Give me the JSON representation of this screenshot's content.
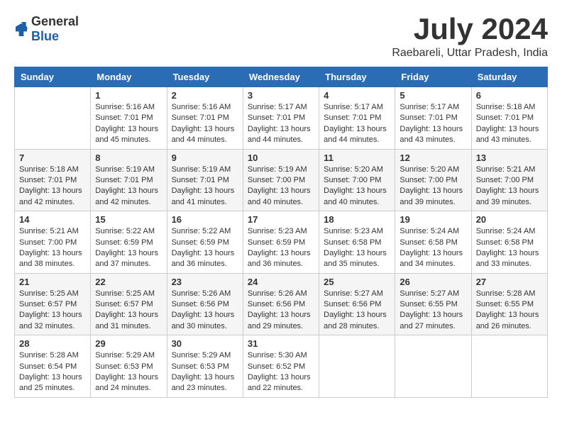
{
  "logo": {
    "text_general": "General",
    "text_blue": "Blue"
  },
  "title": {
    "month_year": "July 2024",
    "location": "Raebareli, Uttar Pradesh, India"
  },
  "headers": [
    "Sunday",
    "Monday",
    "Tuesday",
    "Wednesday",
    "Thursday",
    "Friday",
    "Saturday"
  ],
  "weeks": [
    [
      {
        "day": "",
        "sunrise": "",
        "sunset": "",
        "daylight": ""
      },
      {
        "day": "1",
        "sunrise": "Sunrise: 5:16 AM",
        "sunset": "Sunset: 7:01 PM",
        "daylight": "Daylight: 13 hours and 45 minutes."
      },
      {
        "day": "2",
        "sunrise": "Sunrise: 5:16 AM",
        "sunset": "Sunset: 7:01 PM",
        "daylight": "Daylight: 13 hours and 44 minutes."
      },
      {
        "day": "3",
        "sunrise": "Sunrise: 5:17 AM",
        "sunset": "Sunset: 7:01 PM",
        "daylight": "Daylight: 13 hours and 44 minutes."
      },
      {
        "day": "4",
        "sunrise": "Sunrise: 5:17 AM",
        "sunset": "Sunset: 7:01 PM",
        "daylight": "Daylight: 13 hours and 44 minutes."
      },
      {
        "day": "5",
        "sunrise": "Sunrise: 5:17 AM",
        "sunset": "Sunset: 7:01 PM",
        "daylight": "Daylight: 13 hours and 43 minutes."
      },
      {
        "day": "6",
        "sunrise": "Sunrise: 5:18 AM",
        "sunset": "Sunset: 7:01 PM",
        "daylight": "Daylight: 13 hours and 43 minutes."
      }
    ],
    [
      {
        "day": "7",
        "sunrise": "Sunrise: 5:18 AM",
        "sunset": "Sunset: 7:01 PM",
        "daylight": "Daylight: 13 hours and 42 minutes."
      },
      {
        "day": "8",
        "sunrise": "Sunrise: 5:19 AM",
        "sunset": "Sunset: 7:01 PM",
        "daylight": "Daylight: 13 hours and 42 minutes."
      },
      {
        "day": "9",
        "sunrise": "Sunrise: 5:19 AM",
        "sunset": "Sunset: 7:01 PM",
        "daylight": "Daylight: 13 hours and 41 minutes."
      },
      {
        "day": "10",
        "sunrise": "Sunrise: 5:19 AM",
        "sunset": "Sunset: 7:00 PM",
        "daylight": "Daylight: 13 hours and 40 minutes."
      },
      {
        "day": "11",
        "sunrise": "Sunrise: 5:20 AM",
        "sunset": "Sunset: 7:00 PM",
        "daylight": "Daylight: 13 hours and 40 minutes."
      },
      {
        "day": "12",
        "sunrise": "Sunrise: 5:20 AM",
        "sunset": "Sunset: 7:00 PM",
        "daylight": "Daylight: 13 hours and 39 minutes."
      },
      {
        "day": "13",
        "sunrise": "Sunrise: 5:21 AM",
        "sunset": "Sunset: 7:00 PM",
        "daylight": "Daylight: 13 hours and 39 minutes."
      }
    ],
    [
      {
        "day": "14",
        "sunrise": "Sunrise: 5:21 AM",
        "sunset": "Sunset: 7:00 PM",
        "daylight": "Daylight: 13 hours and 38 minutes."
      },
      {
        "day": "15",
        "sunrise": "Sunrise: 5:22 AM",
        "sunset": "Sunset: 6:59 PM",
        "daylight": "Daylight: 13 hours and 37 minutes."
      },
      {
        "day": "16",
        "sunrise": "Sunrise: 5:22 AM",
        "sunset": "Sunset: 6:59 PM",
        "daylight": "Daylight: 13 hours and 36 minutes."
      },
      {
        "day": "17",
        "sunrise": "Sunrise: 5:23 AM",
        "sunset": "Sunset: 6:59 PM",
        "daylight": "Daylight: 13 hours and 36 minutes."
      },
      {
        "day": "18",
        "sunrise": "Sunrise: 5:23 AM",
        "sunset": "Sunset: 6:58 PM",
        "daylight": "Daylight: 13 hours and 35 minutes."
      },
      {
        "day": "19",
        "sunrise": "Sunrise: 5:24 AM",
        "sunset": "Sunset: 6:58 PM",
        "daylight": "Daylight: 13 hours and 34 minutes."
      },
      {
        "day": "20",
        "sunrise": "Sunrise: 5:24 AM",
        "sunset": "Sunset: 6:58 PM",
        "daylight": "Daylight: 13 hours and 33 minutes."
      }
    ],
    [
      {
        "day": "21",
        "sunrise": "Sunrise: 5:25 AM",
        "sunset": "Sunset: 6:57 PM",
        "daylight": "Daylight: 13 hours and 32 minutes."
      },
      {
        "day": "22",
        "sunrise": "Sunrise: 5:25 AM",
        "sunset": "Sunset: 6:57 PM",
        "daylight": "Daylight: 13 hours and 31 minutes."
      },
      {
        "day": "23",
        "sunrise": "Sunrise: 5:26 AM",
        "sunset": "Sunset: 6:56 PM",
        "daylight": "Daylight: 13 hours and 30 minutes."
      },
      {
        "day": "24",
        "sunrise": "Sunrise: 5:26 AM",
        "sunset": "Sunset: 6:56 PM",
        "daylight": "Daylight: 13 hours and 29 minutes."
      },
      {
        "day": "25",
        "sunrise": "Sunrise: 5:27 AM",
        "sunset": "Sunset: 6:56 PM",
        "daylight": "Daylight: 13 hours and 28 minutes."
      },
      {
        "day": "26",
        "sunrise": "Sunrise: 5:27 AM",
        "sunset": "Sunset: 6:55 PM",
        "daylight": "Daylight: 13 hours and 27 minutes."
      },
      {
        "day": "27",
        "sunrise": "Sunrise: 5:28 AM",
        "sunset": "Sunset: 6:55 PM",
        "daylight": "Daylight: 13 hours and 26 minutes."
      }
    ],
    [
      {
        "day": "28",
        "sunrise": "Sunrise: 5:28 AM",
        "sunset": "Sunset: 6:54 PM",
        "daylight": "Daylight: 13 hours and 25 minutes."
      },
      {
        "day": "29",
        "sunrise": "Sunrise: 5:29 AM",
        "sunset": "Sunset: 6:53 PM",
        "daylight": "Daylight: 13 hours and 24 minutes."
      },
      {
        "day": "30",
        "sunrise": "Sunrise: 5:29 AM",
        "sunset": "Sunset: 6:53 PM",
        "daylight": "Daylight: 13 hours and 23 minutes."
      },
      {
        "day": "31",
        "sunrise": "Sunrise: 5:30 AM",
        "sunset": "Sunset: 6:52 PM",
        "daylight": "Daylight: 13 hours and 22 minutes."
      },
      {
        "day": "",
        "sunrise": "",
        "sunset": "",
        "daylight": ""
      },
      {
        "day": "",
        "sunrise": "",
        "sunset": "",
        "daylight": ""
      },
      {
        "day": "",
        "sunrise": "",
        "sunset": "",
        "daylight": ""
      }
    ]
  ]
}
